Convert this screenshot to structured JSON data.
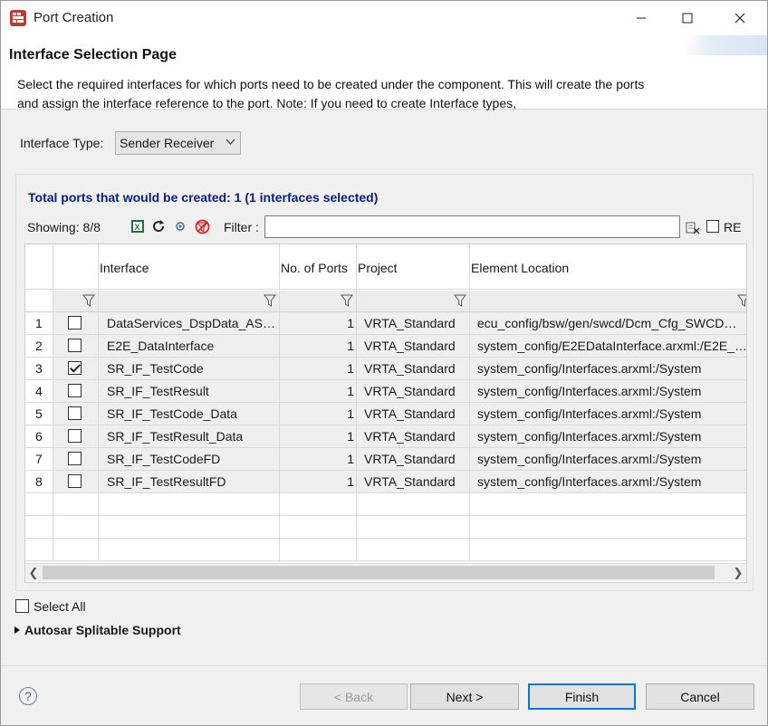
{
  "window": {
    "title": "Port Creation"
  },
  "header": {
    "title": "Interface Selection Page",
    "description": "Select the required interfaces for which ports need to be created under the component. This will create the ports and assign the interface reference to the port. Note: If you need to create Interface types,"
  },
  "interface_type": {
    "label": "Interface Type:",
    "value": "Sender Receiver"
  },
  "summary": {
    "total_text": "Total ports that would be created: 1 (1 interfaces selected)"
  },
  "toolbar": {
    "showing": "Showing: 8/8",
    "filter_label": "Filter :",
    "filter_value": "",
    "re_label": "RE",
    "icons": [
      "excel-export-icon",
      "refresh-icon",
      "filter-settings-icon",
      "clear-filter-icon",
      "clear-text-icon"
    ]
  },
  "table": {
    "columns": [
      "",
      "",
      "Interface",
      "No. of Ports",
      "Project",
      "Element Location"
    ],
    "rows": [
      {
        "index": "1",
        "checked": false,
        "interface": "DataServices_DspData_AS…",
        "ports": "1",
        "project": "VRTA_Standard",
        "location": "ecu_config/bsw/gen/swcd/Dcm_Cfg_SWCD…"
      },
      {
        "index": "2",
        "checked": false,
        "interface": "E2E_DataInterface",
        "ports": "1",
        "project": "VRTA_Standard",
        "location": "system_config/E2EDataInterface.arxml:/E2E_…"
      },
      {
        "index": "3",
        "checked": true,
        "interface": "SR_IF_TestCode",
        "ports": "1",
        "project": "VRTA_Standard",
        "location": "system_config/Interfaces.arxml:/System"
      },
      {
        "index": "4",
        "checked": false,
        "interface": "SR_IF_TestResult",
        "ports": "1",
        "project": "VRTA_Standard",
        "location": "system_config/Interfaces.arxml:/System"
      },
      {
        "index": "5",
        "checked": false,
        "interface": "SR_IF_TestCode_Data",
        "ports": "1",
        "project": "VRTA_Standard",
        "location": "system_config/Interfaces.arxml:/System"
      },
      {
        "index": "6",
        "checked": false,
        "interface": "SR_IF_TestResult_Data",
        "ports": "1",
        "project": "VRTA_Standard",
        "location": "system_config/Interfaces.arxml:/System"
      },
      {
        "index": "7",
        "checked": false,
        "interface": "SR_IF_TestCodeFD",
        "ports": "1",
        "project": "VRTA_Standard",
        "location": "system_config/Interfaces.arxml:/System"
      },
      {
        "index": "8",
        "checked": false,
        "interface": "SR_IF_TestResultFD",
        "ports": "1",
        "project": "VRTA_Standard",
        "location": "system_config/Interfaces.arxml:/System"
      }
    ]
  },
  "select_all": {
    "label": "Select All",
    "checked": false
  },
  "splitable": {
    "label": "Autosar Splitable Support"
  },
  "buttons": {
    "back": "< Back",
    "next": "Next >",
    "finish": "Finish",
    "cancel": "Cancel"
  },
  "colors": {
    "summary_text": "#0b1e7d",
    "default_button_border": "#0078d7"
  }
}
